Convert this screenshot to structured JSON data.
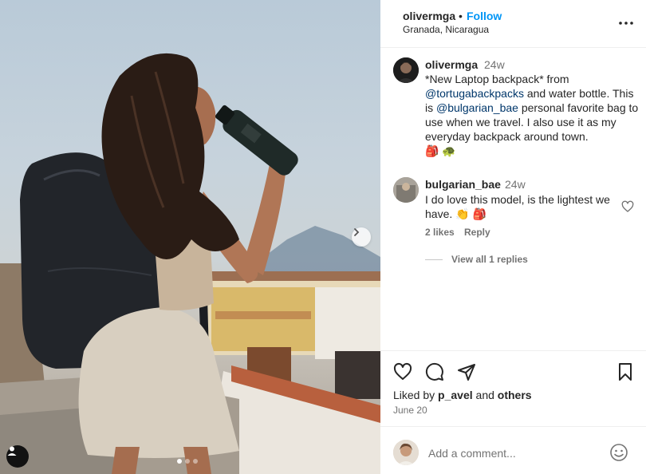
{
  "post": {
    "author": "olivermga",
    "separator": "•",
    "follow_label": "Follow",
    "location": "Granada, Nicaragua"
  },
  "icons": {
    "more": "more-horizontal-icon",
    "next": "chevron-right-icon",
    "tag": "user-tag-icon",
    "heart": "heart-icon",
    "comment": "comment-icon",
    "share": "send-icon",
    "save": "bookmark-icon",
    "emoji": "emoji-smile-icon"
  },
  "carousel": {
    "count": 3,
    "active_index": 0
  },
  "caption": {
    "username": "olivermga",
    "time": "24w",
    "text_1": "*New Laptop backpack* from ",
    "mention_1": "@tortugabackpacks",
    "text_2": " and water bottle. This is ",
    "mention_2": "@bulgarian_bae",
    "text_3": " personal favorite bag to use when we travel. I also use it as my everyday backpack around town.",
    "emojis": "🎒 🐢"
  },
  "comment": {
    "username": "bulgarian_bae",
    "time": "24w",
    "text": "I do love this model, is the lightest we have.",
    "emojis": "👏 🎒",
    "likes": "2 likes",
    "reply_label": "Reply",
    "view_replies": "View all 1 replies"
  },
  "engagement": {
    "liked_prefix": "Liked by ",
    "liked_user": "p_avel",
    "liked_connector": " and ",
    "liked_others": "others",
    "date": "June 20"
  },
  "add_comment": {
    "placeholder": "Add a comment..."
  },
  "colors": {
    "accent": "#0095f6",
    "mention": "#00376b",
    "text": "#262626",
    "secondary": "#737373",
    "divider": "#efefef"
  }
}
